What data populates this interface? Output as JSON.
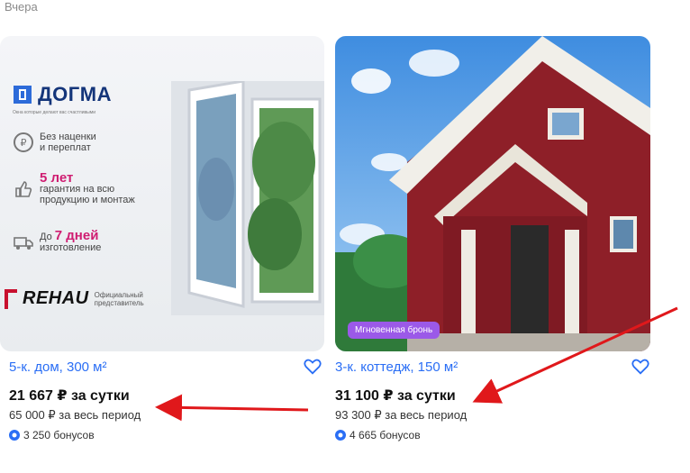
{
  "header": {
    "date_label": "Вчера"
  },
  "cards": [
    {
      "title": "5-к. дом, 300 м²",
      "price": "21 667 ₽ за сутки",
      "period_price": "65 000 ₽ за весь период",
      "bonus": "3 250 бонусов",
      "ad": {
        "logo": "ДОГМА",
        "tagline": "Окна которые делают вас счастливыми",
        "features": [
          {
            "line1": "Без наценки",
            "line2": "и переплат"
          },
          {
            "strong": "5 лет",
            "line1": "гарантия на всю",
            "line2": "продукцию и монтаж"
          },
          {
            "prefix": "До",
            "strong": "7 дней",
            "line2": "изготовление"
          }
        ],
        "brand": "REHAU",
        "brand_sub1": "Официальный",
        "brand_sub2": "представитель"
      }
    },
    {
      "title": "3-к. коттедж, 150 м²",
      "price": "31 100 ₽ за сутки",
      "period_price": "93 300 ₽ за весь период",
      "bonus": "4 665 бонусов",
      "badge": "Мгновенная бронь"
    }
  ],
  "colors": {
    "accent": "#2a6ef5",
    "badge": "#9b59e8",
    "arrow": "#e0181b"
  },
  "icons": [
    "heart-icon",
    "bonus-icon"
  ]
}
